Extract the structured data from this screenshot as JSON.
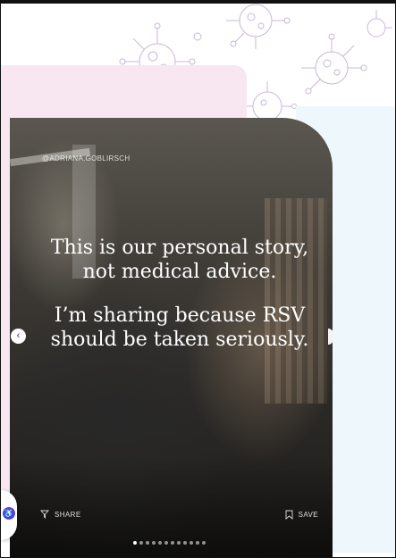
{
  "story": {
    "handle": "@ADRIANA.GOBLIRSCH",
    "paragraph_1": "This is our personal story, not medical advice.",
    "paragraph_2": "I’m sharing because RSV should be taken seriously.",
    "share_label": "SHARE",
    "save_label": "SAVE"
  },
  "carousel": {
    "slide_count": 12,
    "active_index": 0,
    "prev_icon": "chevron-left-icon",
    "next_icon": "chevron-right-icon"
  },
  "colors": {
    "pink_block": "#f8e6f0",
    "blue_block": "#eef7fb",
    "virus_outline": "#c9b7d8",
    "fab": "#6e3bd6"
  },
  "icons": {
    "share": "share-icon",
    "save": "bookmark-icon",
    "fab": "accessibility-icon",
    "decor": "virus-icon"
  }
}
